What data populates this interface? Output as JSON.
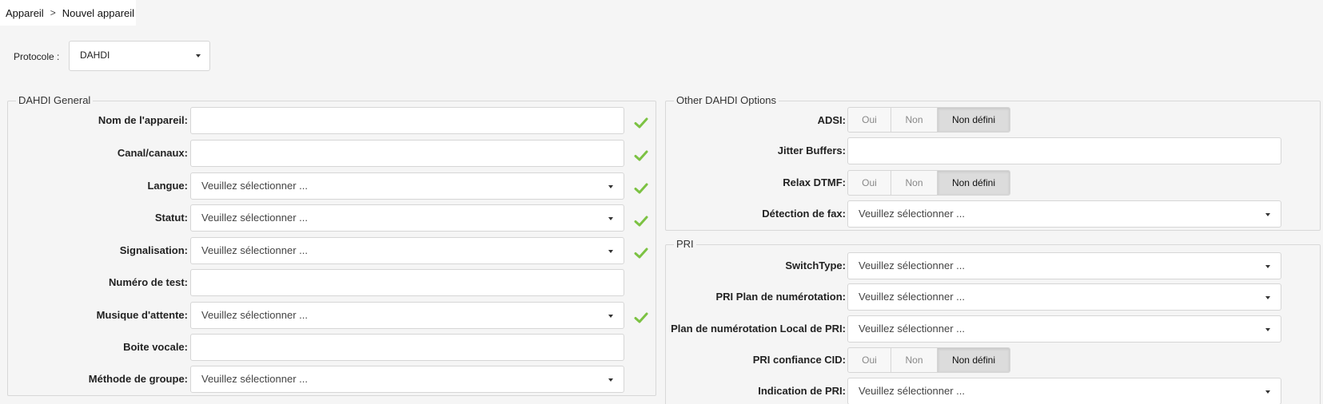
{
  "breadcrumb": {
    "parent": "Appareil",
    "separator": ">",
    "current": "Nouvel appareil"
  },
  "protocol": {
    "label": "Protocole :",
    "value": "DAHDI"
  },
  "general": {
    "legend": "DAHDI General",
    "name_label": "Nom de l'appareil:",
    "channels_label": "Canal/canaux:",
    "language_label": "Langue:",
    "language_value": "Veuillez sélectionner ...",
    "status_label": "Statut:",
    "status_value": "Veuillez sélectionner ...",
    "signalling_label": "Signalisation:",
    "signalling_value": "Veuillez sélectionner ...",
    "test_number_label": "Numéro de test:",
    "moh_label": "Musique d'attente:",
    "moh_value": "Veuillez sélectionner ...",
    "voicemail_label": "Boite vocale:",
    "group_method_label": "Méthode de groupe:",
    "group_method_value": "Veuillez sélectionner ..."
  },
  "other": {
    "legend": "Other DAHDI Options",
    "adsi_label": "ADSI:",
    "jitter_label": "Jitter Buffers:",
    "relax_dtmf_label": "Relax DTMF:",
    "fax_label": "Détection de fax:",
    "fax_value": "Veuillez sélectionner ..."
  },
  "toggle": {
    "yes": "Oui",
    "no": "Non",
    "undefined": "Non défini"
  },
  "pri": {
    "legend": "PRI",
    "switchtype_label": "SwitchType:",
    "switchtype_value": "Veuillez sélectionner ...",
    "dialplan_label": "PRI Plan de numérotation:",
    "dialplan_value": "Veuillez sélectionner ...",
    "local_dialplan_label": "Plan de numérotation Local de PRI:",
    "local_dialplan_value": "Veuillez sélectionner ...",
    "trust_cid_label": "PRI confiance CID:",
    "indication_label": "Indication de PRI:",
    "indication_value": "Veuillez sélectionner ..."
  },
  "colors": {
    "check": "#7cc243",
    "toggle_active": "#dcdcdc"
  }
}
